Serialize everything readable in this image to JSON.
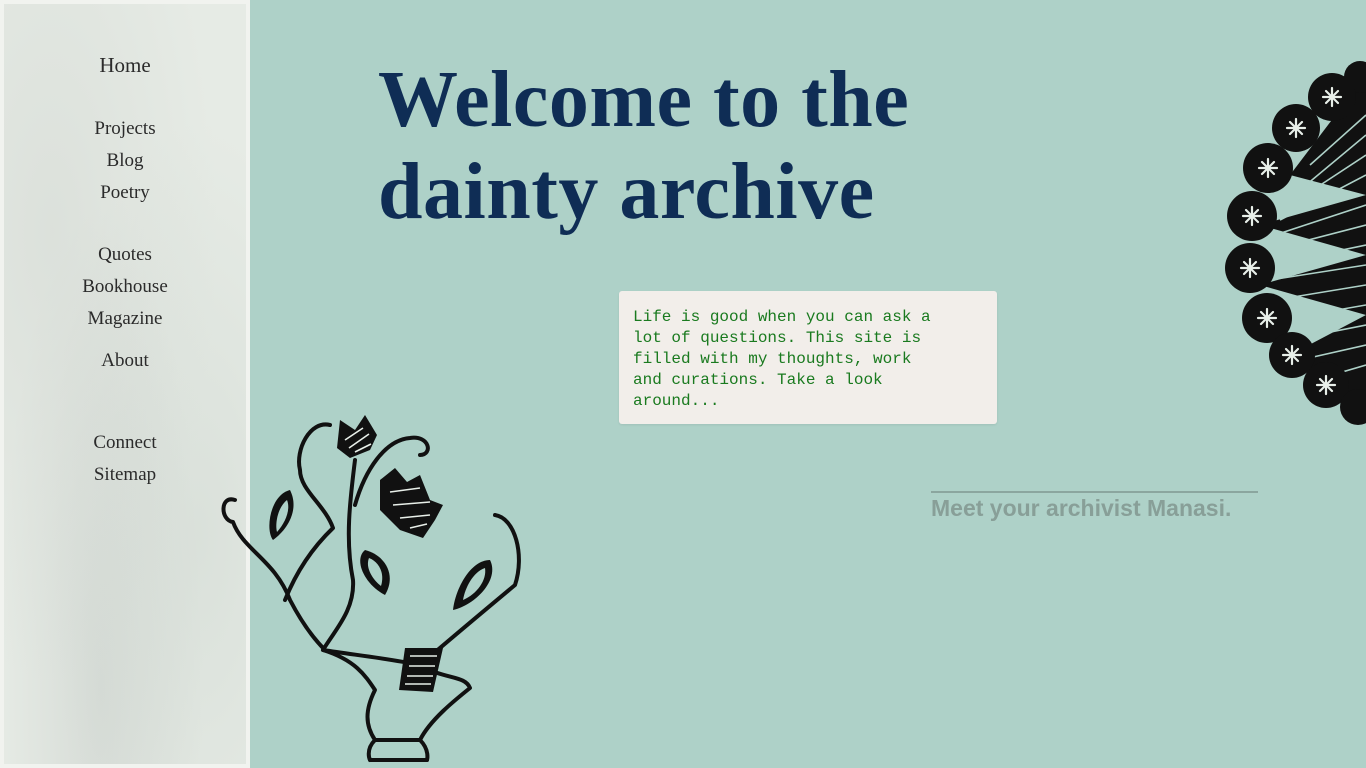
{
  "sidebar": {
    "home": "Home",
    "items": [
      {
        "label": "Projects"
      },
      {
        "label": "Blog"
      },
      {
        "label": "Poetry"
      },
      {
        "label": "Quotes"
      },
      {
        "label": "Bookhouse"
      },
      {
        "label": "Magazine"
      },
      {
        "label": "About"
      },
      {
        "label": "Connect"
      },
      {
        "label": "Sitemap"
      }
    ]
  },
  "main": {
    "title_line1": "Welcome to the",
    "title_line2": "dainty archive",
    "intro_lines": [
      "Life is good when you can ask a",
      "lot of questions. This site is",
      "filled with my thoughts, work",
      "and curations. Take a look",
      "around..."
    ],
    "archivist_link": "Meet your archivist Manasi."
  },
  "decorations": {
    "plant": "plant-sketch-icon",
    "mandala": "mandala-flower-icon"
  },
  "colors": {
    "background": "#aed1c8",
    "sidebar": "#e6ebe5",
    "title": "#0f2d55",
    "intro_text": "#1a7a1f",
    "intro_card": "#f2eeea",
    "archivist_link": "#889f98"
  }
}
